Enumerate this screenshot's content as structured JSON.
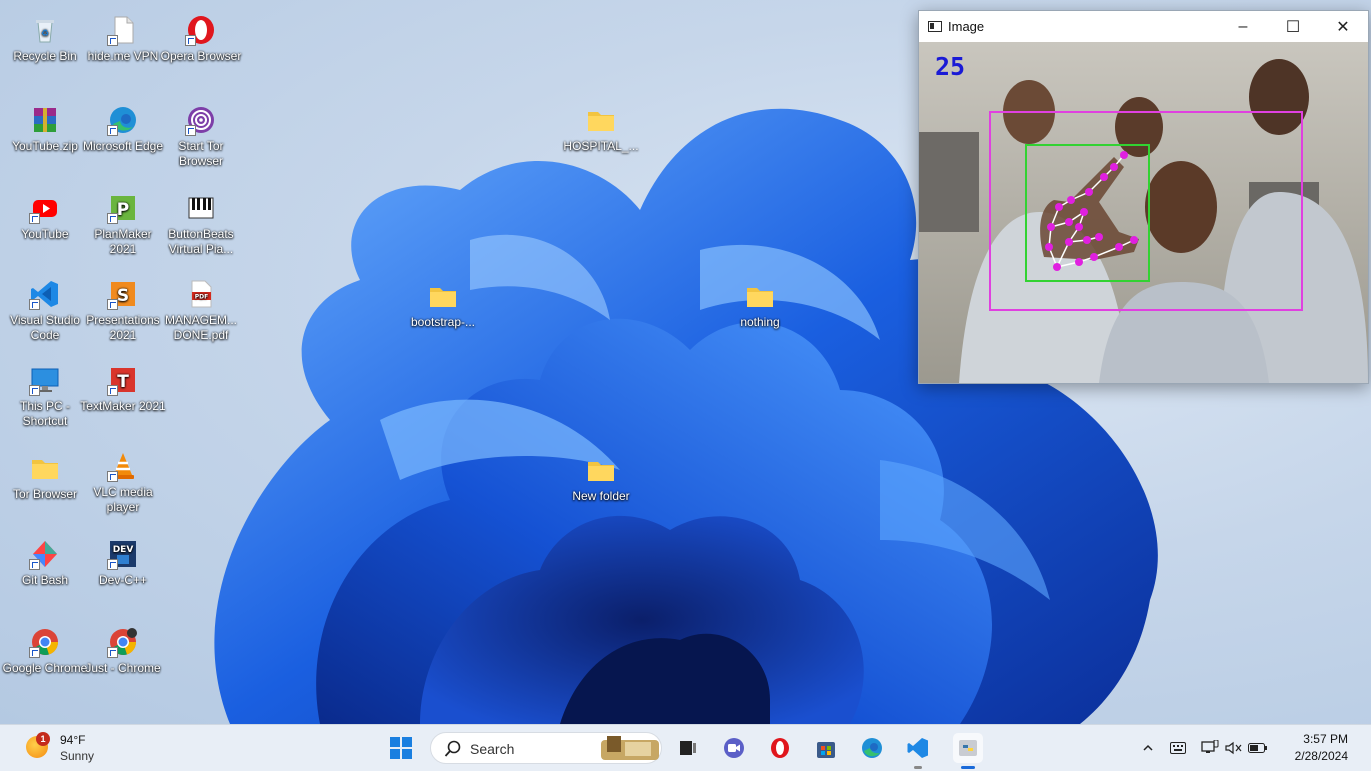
{
  "desktop": {
    "icons": [
      {
        "label": "Recycle Bin",
        "icon": "recycle-bin-icon"
      },
      {
        "label": "hide.me VPN",
        "icon": "blank-file-icon"
      },
      {
        "label": "Opera Browser",
        "icon": "opera-icon"
      },
      {
        "label": "YouTube.zip",
        "icon": "winrar-archive-icon"
      },
      {
        "label": "Microsoft Edge",
        "icon": "edge-icon"
      },
      {
        "label": "Start Tor Browser",
        "icon": "tor-onion-icon"
      },
      {
        "label": "YouTube",
        "icon": "youtube-icon"
      },
      {
        "label": "PlanMaker 2021",
        "icon": "planmaker-icon"
      },
      {
        "label": "ButtonBeats Virtual Pia...",
        "icon": "piano-icon"
      },
      {
        "label": "Visual Studio Code",
        "icon": "vscode-icon"
      },
      {
        "label": "Presentations 2021",
        "icon": "presentations-icon"
      },
      {
        "label": "MANAGEM... DONE.pdf",
        "icon": "pdf-icon"
      },
      {
        "label": "This PC - Shortcut",
        "icon": "monitor-icon"
      },
      {
        "label": "TextMaker 2021",
        "icon": "textmaker-icon"
      },
      {
        "label": "Tor Browser",
        "icon": "folder-icon"
      },
      {
        "label": "VLC media player",
        "icon": "vlc-cone-icon"
      },
      {
        "label": "Git Bash",
        "icon": "git-bash-icon"
      },
      {
        "label": "Dev-C++",
        "icon": "dev-cpp-icon"
      },
      {
        "label": "Google Chrome",
        "icon": "chrome-icon"
      },
      {
        "label": "Just - Chrome",
        "icon": "chrome-profile-icon"
      },
      {
        "label": "HOSPITAL_...",
        "icon": "folder-icon"
      },
      {
        "label": "bootstrap-...",
        "icon": "folder-icon"
      },
      {
        "label": "nothing",
        "icon": "folder-icon"
      },
      {
        "label": "New folder",
        "icon": "folder-icon"
      }
    ]
  },
  "window": {
    "title": "Image",
    "minimize": "–",
    "maximize": "☐",
    "close": "✕",
    "finger_count": "25"
  },
  "taskbar": {
    "weather": {
      "badge": "1",
      "temp": "94°F",
      "condition": "Sunny"
    },
    "search_placeholder": "Search",
    "pinned": [
      "start-windows-icon",
      "search-icon",
      "widgets-news-icon",
      "task-view-icon",
      "zoom-icon",
      "opera-icon",
      "store-bag-icon",
      "edge-icon",
      "vscode-icon",
      "python-icon"
    ],
    "clock": {
      "time": "3:57 PM",
      "date": "2/28/2024"
    },
    "tray_icons": [
      "chevron-up-icon",
      "keyboard-icon",
      "network-icon",
      "volume-muted-icon",
      "battery-icon"
    ]
  },
  "colors": {
    "wallpaper_blue": "#1a5fe0",
    "taskbar_bg": "#e8eef6",
    "hand_box_outer": "#e040e0",
    "hand_box_inner": "#32d232",
    "landmark": "#e020e0",
    "count_text": "#1a1ad6"
  }
}
